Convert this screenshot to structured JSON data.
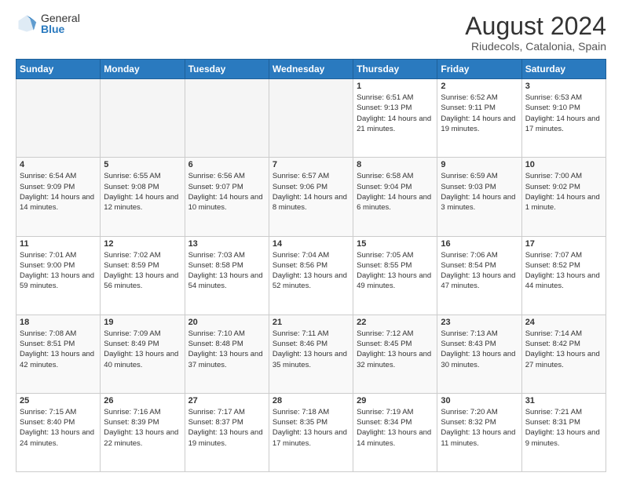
{
  "header": {
    "logo_general": "General",
    "logo_blue": "Blue",
    "title": "August 2024",
    "subtitle": "Riudecols, Catalonia, Spain"
  },
  "days_of_week": [
    "Sunday",
    "Monday",
    "Tuesday",
    "Wednesday",
    "Thursday",
    "Friday",
    "Saturday"
  ],
  "weeks": [
    [
      {
        "day": "",
        "empty": true
      },
      {
        "day": "",
        "empty": true
      },
      {
        "day": "",
        "empty": true
      },
      {
        "day": "",
        "empty": true
      },
      {
        "day": "1",
        "sunrise": "6:51 AM",
        "sunset": "9:13 PM",
        "daylight": "14 hours and 21 minutes."
      },
      {
        "day": "2",
        "sunrise": "6:52 AM",
        "sunset": "9:11 PM",
        "daylight": "14 hours and 19 minutes."
      },
      {
        "day": "3",
        "sunrise": "6:53 AM",
        "sunset": "9:10 PM",
        "daylight": "14 hours and 17 minutes."
      }
    ],
    [
      {
        "day": "4",
        "sunrise": "6:54 AM",
        "sunset": "9:09 PM",
        "daylight": "14 hours and 14 minutes."
      },
      {
        "day": "5",
        "sunrise": "6:55 AM",
        "sunset": "9:08 PM",
        "daylight": "14 hours and 12 minutes."
      },
      {
        "day": "6",
        "sunrise": "6:56 AM",
        "sunset": "9:07 PM",
        "daylight": "14 hours and 10 minutes."
      },
      {
        "day": "7",
        "sunrise": "6:57 AM",
        "sunset": "9:06 PM",
        "daylight": "14 hours and 8 minutes."
      },
      {
        "day": "8",
        "sunrise": "6:58 AM",
        "sunset": "9:04 PM",
        "daylight": "14 hours and 6 minutes."
      },
      {
        "day": "9",
        "sunrise": "6:59 AM",
        "sunset": "9:03 PM",
        "daylight": "14 hours and 3 minutes."
      },
      {
        "day": "10",
        "sunrise": "7:00 AM",
        "sunset": "9:02 PM",
        "daylight": "14 hours and 1 minute."
      }
    ],
    [
      {
        "day": "11",
        "sunrise": "7:01 AM",
        "sunset": "9:00 PM",
        "daylight": "13 hours and 59 minutes."
      },
      {
        "day": "12",
        "sunrise": "7:02 AM",
        "sunset": "8:59 PM",
        "daylight": "13 hours and 56 minutes."
      },
      {
        "day": "13",
        "sunrise": "7:03 AM",
        "sunset": "8:58 PM",
        "daylight": "13 hours and 54 minutes."
      },
      {
        "day": "14",
        "sunrise": "7:04 AM",
        "sunset": "8:56 PM",
        "daylight": "13 hours and 52 minutes."
      },
      {
        "day": "15",
        "sunrise": "7:05 AM",
        "sunset": "8:55 PM",
        "daylight": "13 hours and 49 minutes."
      },
      {
        "day": "16",
        "sunrise": "7:06 AM",
        "sunset": "8:54 PM",
        "daylight": "13 hours and 47 minutes."
      },
      {
        "day": "17",
        "sunrise": "7:07 AM",
        "sunset": "8:52 PM",
        "daylight": "13 hours and 44 minutes."
      }
    ],
    [
      {
        "day": "18",
        "sunrise": "7:08 AM",
        "sunset": "8:51 PM",
        "daylight": "13 hours and 42 minutes."
      },
      {
        "day": "19",
        "sunrise": "7:09 AM",
        "sunset": "8:49 PM",
        "daylight": "13 hours and 40 minutes."
      },
      {
        "day": "20",
        "sunrise": "7:10 AM",
        "sunset": "8:48 PM",
        "daylight": "13 hours and 37 minutes."
      },
      {
        "day": "21",
        "sunrise": "7:11 AM",
        "sunset": "8:46 PM",
        "daylight": "13 hours and 35 minutes."
      },
      {
        "day": "22",
        "sunrise": "7:12 AM",
        "sunset": "8:45 PM",
        "daylight": "13 hours and 32 minutes."
      },
      {
        "day": "23",
        "sunrise": "7:13 AM",
        "sunset": "8:43 PM",
        "daylight": "13 hours and 30 minutes."
      },
      {
        "day": "24",
        "sunrise": "7:14 AM",
        "sunset": "8:42 PM",
        "daylight": "13 hours and 27 minutes."
      }
    ],
    [
      {
        "day": "25",
        "sunrise": "7:15 AM",
        "sunset": "8:40 PM",
        "daylight": "13 hours and 24 minutes."
      },
      {
        "day": "26",
        "sunrise": "7:16 AM",
        "sunset": "8:39 PM",
        "daylight": "13 hours and 22 minutes."
      },
      {
        "day": "27",
        "sunrise": "7:17 AM",
        "sunset": "8:37 PM",
        "daylight": "13 hours and 19 minutes."
      },
      {
        "day": "28",
        "sunrise": "7:18 AM",
        "sunset": "8:35 PM",
        "daylight": "13 hours and 17 minutes."
      },
      {
        "day": "29",
        "sunrise": "7:19 AM",
        "sunset": "8:34 PM",
        "daylight": "13 hours and 14 minutes."
      },
      {
        "day": "30",
        "sunrise": "7:20 AM",
        "sunset": "8:32 PM",
        "daylight": "13 hours and 11 minutes."
      },
      {
        "day": "31",
        "sunrise": "7:21 AM",
        "sunset": "8:31 PM",
        "daylight": "13 hours and 9 minutes."
      }
    ]
  ],
  "labels": {
    "sunrise": "Sunrise:",
    "sunset": "Sunset:",
    "daylight": "Daylight hours"
  }
}
